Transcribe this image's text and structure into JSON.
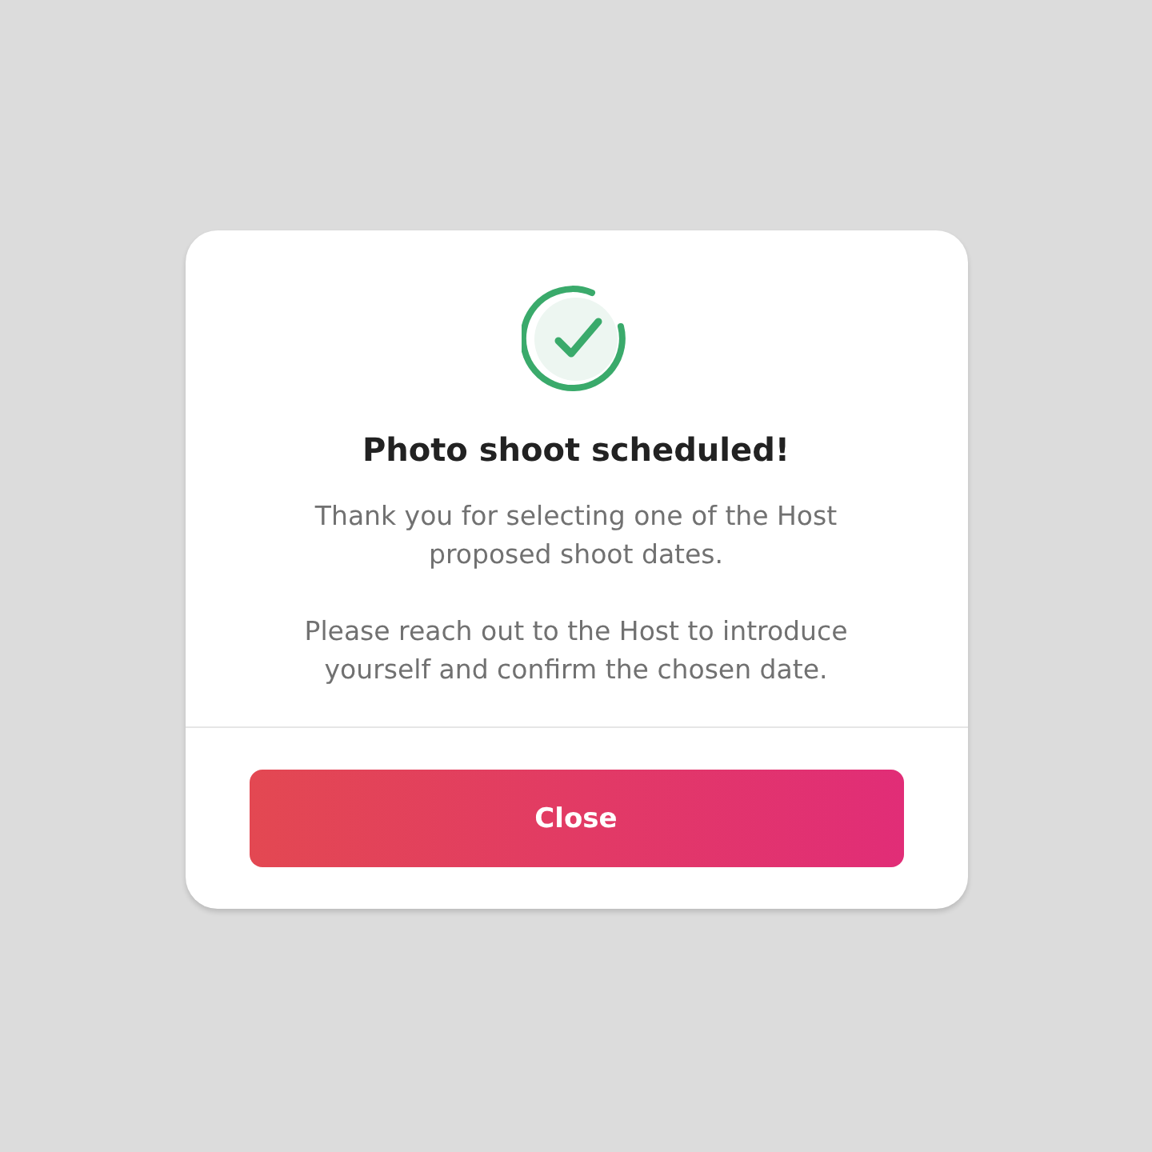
{
  "dialog": {
    "title": "Photo shoot scheduled!",
    "paragraphs": [
      "Thank you for selecting one of the Host proposed shoot dates.",
      "Please reach out to the Host to introduce yourself and confirm the chosen date."
    ],
    "button": "Close"
  }
}
